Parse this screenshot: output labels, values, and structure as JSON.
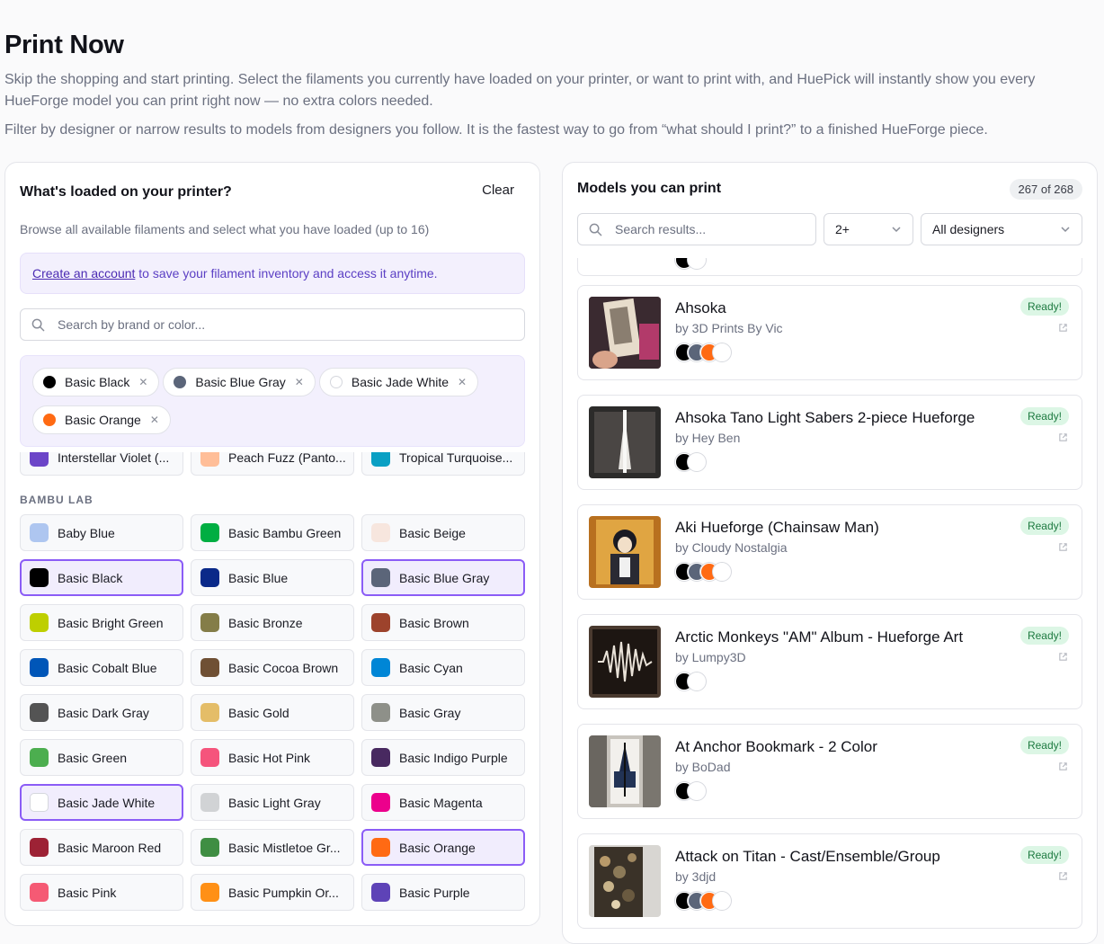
{
  "header": {
    "title": "Print Now",
    "desc1": "Skip the shopping and start printing. Select the filaments you currently have loaded on your printer, or want to print with, and HuePick will instantly show you every HueForge model you can print right now — no extra colors needed.",
    "desc2": "Filter by designer or narrow results to models from designers you follow. It is the fastest way to go from “what should I print?” to a finished HueForge piece."
  },
  "left": {
    "title": "What's loaded on your printer?",
    "clear": "Clear",
    "subtitle": "Browse all available filaments and select what you have loaded (up to 16)",
    "notice_link": "Create an account",
    "notice_rest": " to save your filament inventory and access it anytime.",
    "search_placeholder": "Search by brand or color...",
    "chips": [
      {
        "label": "Basic Black",
        "color": "#000000"
      },
      {
        "label": "Basic Blue Gray",
        "color": "#5b6579"
      },
      {
        "label": "Basic Jade White",
        "color": "#ffffff"
      },
      {
        "label": "Basic Orange",
        "color": "#ff6a13"
      }
    ],
    "cut_row": [
      {
        "label": "Interstellar Violet (...",
        "color": "#6c45c8"
      },
      {
        "label": "Peach Fuzz (Panto...",
        "color": "#ffbe98"
      },
      {
        "label": "Tropical Turquoise...",
        "color": "#0aa0c4"
      }
    ],
    "section": "BAMBU LAB",
    "filaments": [
      {
        "label": "Baby Blue",
        "color": "#aec6f0",
        "selected": false
      },
      {
        "label": "Basic Bambu Green",
        "color": "#00ae42",
        "selected": false
      },
      {
        "label": "Basic Beige",
        "color": "#f7e6de",
        "selected": false
      },
      {
        "label": "Basic Black",
        "color": "#000000",
        "selected": true
      },
      {
        "label": "Basic Blue",
        "color": "#0a2989",
        "selected": false
      },
      {
        "label": "Basic Blue Gray",
        "color": "#5b6579",
        "selected": true
      },
      {
        "label": "Basic Bright Green",
        "color": "#becf00",
        "selected": false
      },
      {
        "label": "Basic Bronze",
        "color": "#847d48",
        "selected": false
      },
      {
        "label": "Basic Brown",
        "color": "#9d432c",
        "selected": false
      },
      {
        "label": "Basic Cobalt Blue",
        "color": "#0056b8",
        "selected": false
      },
      {
        "label": "Basic Cocoa Brown",
        "color": "#6f5034",
        "selected": false
      },
      {
        "label": "Basic Cyan",
        "color": "#0086d6",
        "selected": false
      },
      {
        "label": "Basic Dark Gray",
        "color": "#545454",
        "selected": false
      },
      {
        "label": "Basic Gold",
        "color": "#e4bd68",
        "selected": false
      },
      {
        "label": "Basic Gray",
        "color": "#8e9089",
        "selected": false
      },
      {
        "label": "Basic Green",
        "color": "#4cae4f",
        "selected": false
      },
      {
        "label": "Basic Hot Pink",
        "color": "#f5547c",
        "selected": false
      },
      {
        "label": "Basic Indigo Purple",
        "color": "#482960",
        "selected": false
      },
      {
        "label": "Basic Jade White",
        "color": "#ffffff",
        "selected": true
      },
      {
        "label": "Basic Light Gray",
        "color": "#d1d3d5",
        "selected": false
      },
      {
        "label": "Basic Magenta",
        "color": "#ec008c",
        "selected": false
      },
      {
        "label": "Basic Maroon Red",
        "color": "#9d2235",
        "selected": false
      },
      {
        "label": "Basic Mistletoe Gr...",
        "color": "#3f8e43",
        "selected": false
      },
      {
        "label": "Basic Orange",
        "color": "#ff6a13",
        "selected": true
      },
      {
        "label": "Basic Pink",
        "color": "#f55a74",
        "selected": false
      },
      {
        "label": "Basic Pumpkin Or...",
        "color": "#ff9016",
        "selected": false
      },
      {
        "label": "Basic Purple",
        "color": "#5e43b7",
        "selected": false
      }
    ]
  },
  "right": {
    "title": "Models you can print",
    "count": "267 of 268",
    "search_placeholder": "Search results...",
    "filter_value": "2+",
    "designer_value": "All designers",
    "ready_label": "Ready!",
    "models": [
      {
        "name": "Ahsoka",
        "by": "by 3D Prints By Vic",
        "colors": [
          "#000000",
          "#5b6579",
          "#ff6a13",
          "#ffffff"
        ],
        "thumb": "ahsoka"
      },
      {
        "name": "Ahsoka Tano Light Sabers 2-piece Hueforge",
        "by": "by Hey Ben",
        "colors": [
          "#000000",
          "#ffffff"
        ],
        "thumb": "sabers"
      },
      {
        "name": "Aki Hueforge (Chainsaw Man)",
        "by": "by Cloudy Nostalgia",
        "colors": [
          "#000000",
          "#5b6579",
          "#ff6a13",
          "#ffffff"
        ],
        "thumb": "aki"
      },
      {
        "name": "Arctic Monkeys \"AM\" Album - Hueforge Art",
        "by": "by Lumpy3D",
        "colors": [
          "#000000",
          "#ffffff"
        ],
        "thumb": "am"
      },
      {
        "name": "At Anchor Bookmark - 2 Color",
        "by": "by BoDad",
        "colors": [
          "#000000",
          "#ffffff"
        ],
        "thumb": "anchor"
      },
      {
        "name": "Attack on Titan - Cast/Ensemble/Group",
        "by": "by 3djd",
        "colors": [
          "#000000",
          "#5b6579",
          "#ff6a13",
          "#ffffff"
        ],
        "thumb": "titan"
      }
    ]
  }
}
